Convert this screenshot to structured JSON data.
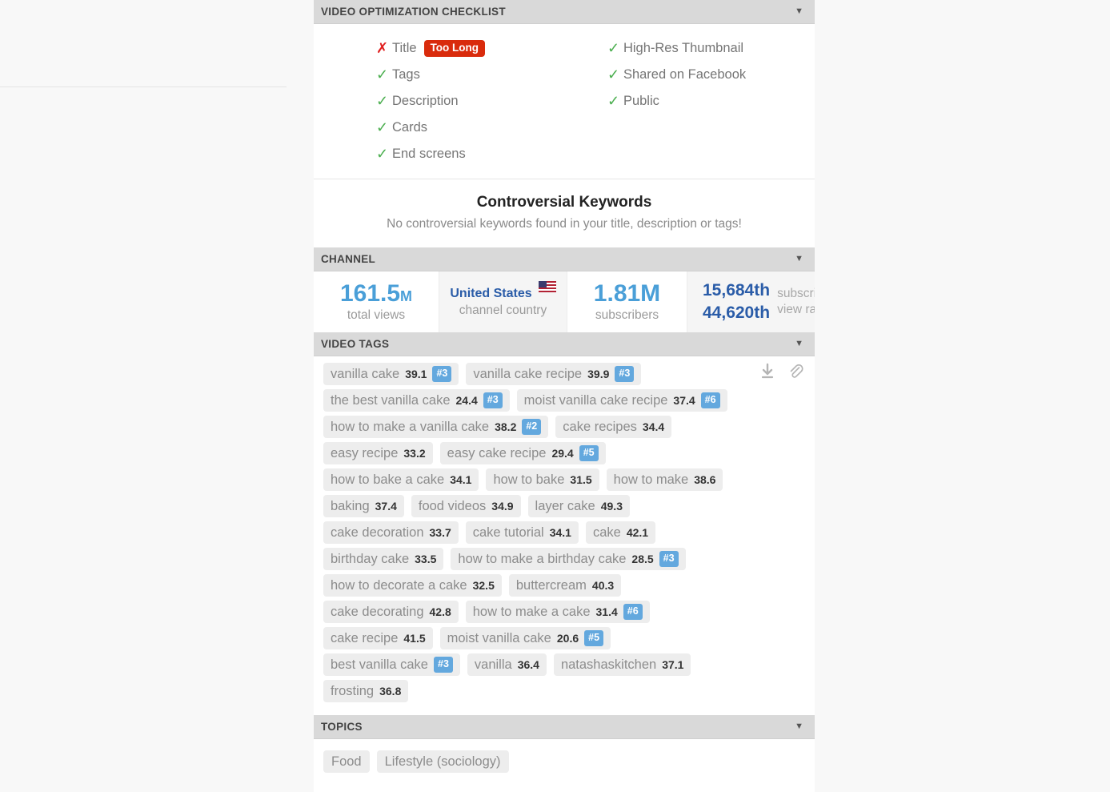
{
  "sections": {
    "checklist": {
      "title": "VIDEO OPTIMIZATION CHECKLIST",
      "caret": "▼",
      "left_items": [
        {
          "label": "Title",
          "status": "fail",
          "mark": "✗",
          "badge": "Too Long"
        },
        {
          "label": "Tags",
          "status": "ok",
          "mark": "✓",
          "badge": ""
        },
        {
          "label": "Description",
          "status": "ok",
          "mark": "✓",
          "badge": ""
        },
        {
          "label": "Cards",
          "status": "ok",
          "mark": "✓",
          "badge": ""
        },
        {
          "label": "End screens",
          "status": "ok",
          "mark": "✓",
          "badge": ""
        }
      ],
      "right_items": [
        {
          "label": "High-Res Thumbnail",
          "status": "ok",
          "mark": "✓",
          "badge": ""
        },
        {
          "label": "Shared on Facebook",
          "status": "ok",
          "mark": "✓",
          "badge": ""
        },
        {
          "label": "Public",
          "status": "ok",
          "mark": "✓",
          "badge": ""
        }
      ]
    },
    "controversial": {
      "title": "Controversial Keywords",
      "message": "No controversial keywords found in your title, description or tags!"
    },
    "channel": {
      "title": "CHANNEL",
      "caret": "▼",
      "total_views_value": "161.5",
      "total_views_suffix": "M",
      "total_views_label": "total views",
      "country_name": "United States",
      "country_label": "channel country",
      "subscribers_value": "1.81M",
      "subscribers_label": "subscribers",
      "subscriber_rank_value": "15,684th",
      "subscriber_rank_label": "subscriber rank",
      "view_rank_value": "44,620th",
      "view_rank_label": "view rank"
    },
    "video_tags": {
      "title": "VIDEO TAGS",
      "caret": "▼",
      "download_icon": "download-icon",
      "attach_icon": "paperclip-icon",
      "rows": [
        [
          {
            "text": "vanilla cake",
            "score": "39.1",
            "rank": "#3"
          },
          {
            "text": "vanilla cake recipe",
            "score": "39.9",
            "rank": "#3"
          }
        ],
        [
          {
            "text": "the best vanilla cake",
            "score": "24.4",
            "rank": "#3"
          },
          {
            "text": "moist vanilla cake recipe",
            "score": "37.4",
            "rank": "#6"
          }
        ],
        [
          {
            "text": "how to make a vanilla cake",
            "score": "38.2",
            "rank": "#2"
          },
          {
            "text": "cake recipes",
            "score": "34.4",
            "rank": ""
          }
        ],
        [
          {
            "text": "easy recipe",
            "score": "33.2",
            "rank": ""
          },
          {
            "text": "easy cake recipe",
            "score": "29.4",
            "rank": "#5"
          }
        ],
        [
          {
            "text": "how to bake a cake",
            "score": "34.1",
            "rank": ""
          },
          {
            "text": "how to bake",
            "score": "31.5",
            "rank": ""
          },
          {
            "text": "how to make",
            "score": "38.6",
            "rank": ""
          }
        ],
        [
          {
            "text": "baking",
            "score": "37.4",
            "rank": ""
          },
          {
            "text": "food videos",
            "score": "34.9",
            "rank": ""
          },
          {
            "text": "layer cake",
            "score": "49.3",
            "rank": ""
          }
        ],
        [
          {
            "text": "cake decoration",
            "score": "33.7",
            "rank": ""
          },
          {
            "text": "cake tutorial",
            "score": "34.1",
            "rank": ""
          },
          {
            "text": "cake",
            "score": "42.1",
            "rank": ""
          }
        ],
        [
          {
            "text": "birthday cake",
            "score": "33.5",
            "rank": ""
          },
          {
            "text": "how to make a birthday cake",
            "score": "28.5",
            "rank": "#3"
          }
        ],
        [
          {
            "text": "how to decorate a cake",
            "score": "32.5",
            "rank": ""
          },
          {
            "text": "buttercream",
            "score": "40.3",
            "rank": ""
          }
        ],
        [
          {
            "text": "cake decorating",
            "score": "42.8",
            "rank": ""
          },
          {
            "text": "how to make a cake",
            "score": "31.4",
            "rank": "#6"
          }
        ],
        [
          {
            "text": "cake recipe",
            "score": "41.5",
            "rank": ""
          },
          {
            "text": "moist vanilla cake",
            "score": "20.6",
            "rank": "#5"
          }
        ],
        [
          {
            "text": "best vanilla cake",
            "score": "",
            "rank": "#3"
          },
          {
            "text": "vanilla",
            "score": "36.4",
            "rank": ""
          },
          {
            "text": "natashaskitchen",
            "score": "37.1",
            "rank": ""
          }
        ],
        [
          {
            "text": "frosting",
            "score": "36.8",
            "rank": ""
          }
        ]
      ]
    },
    "topics": {
      "title": "TOPICS",
      "caret": "▼",
      "items": [
        "Food",
        "Lifestyle (sociology)"
      ]
    }
  }
}
